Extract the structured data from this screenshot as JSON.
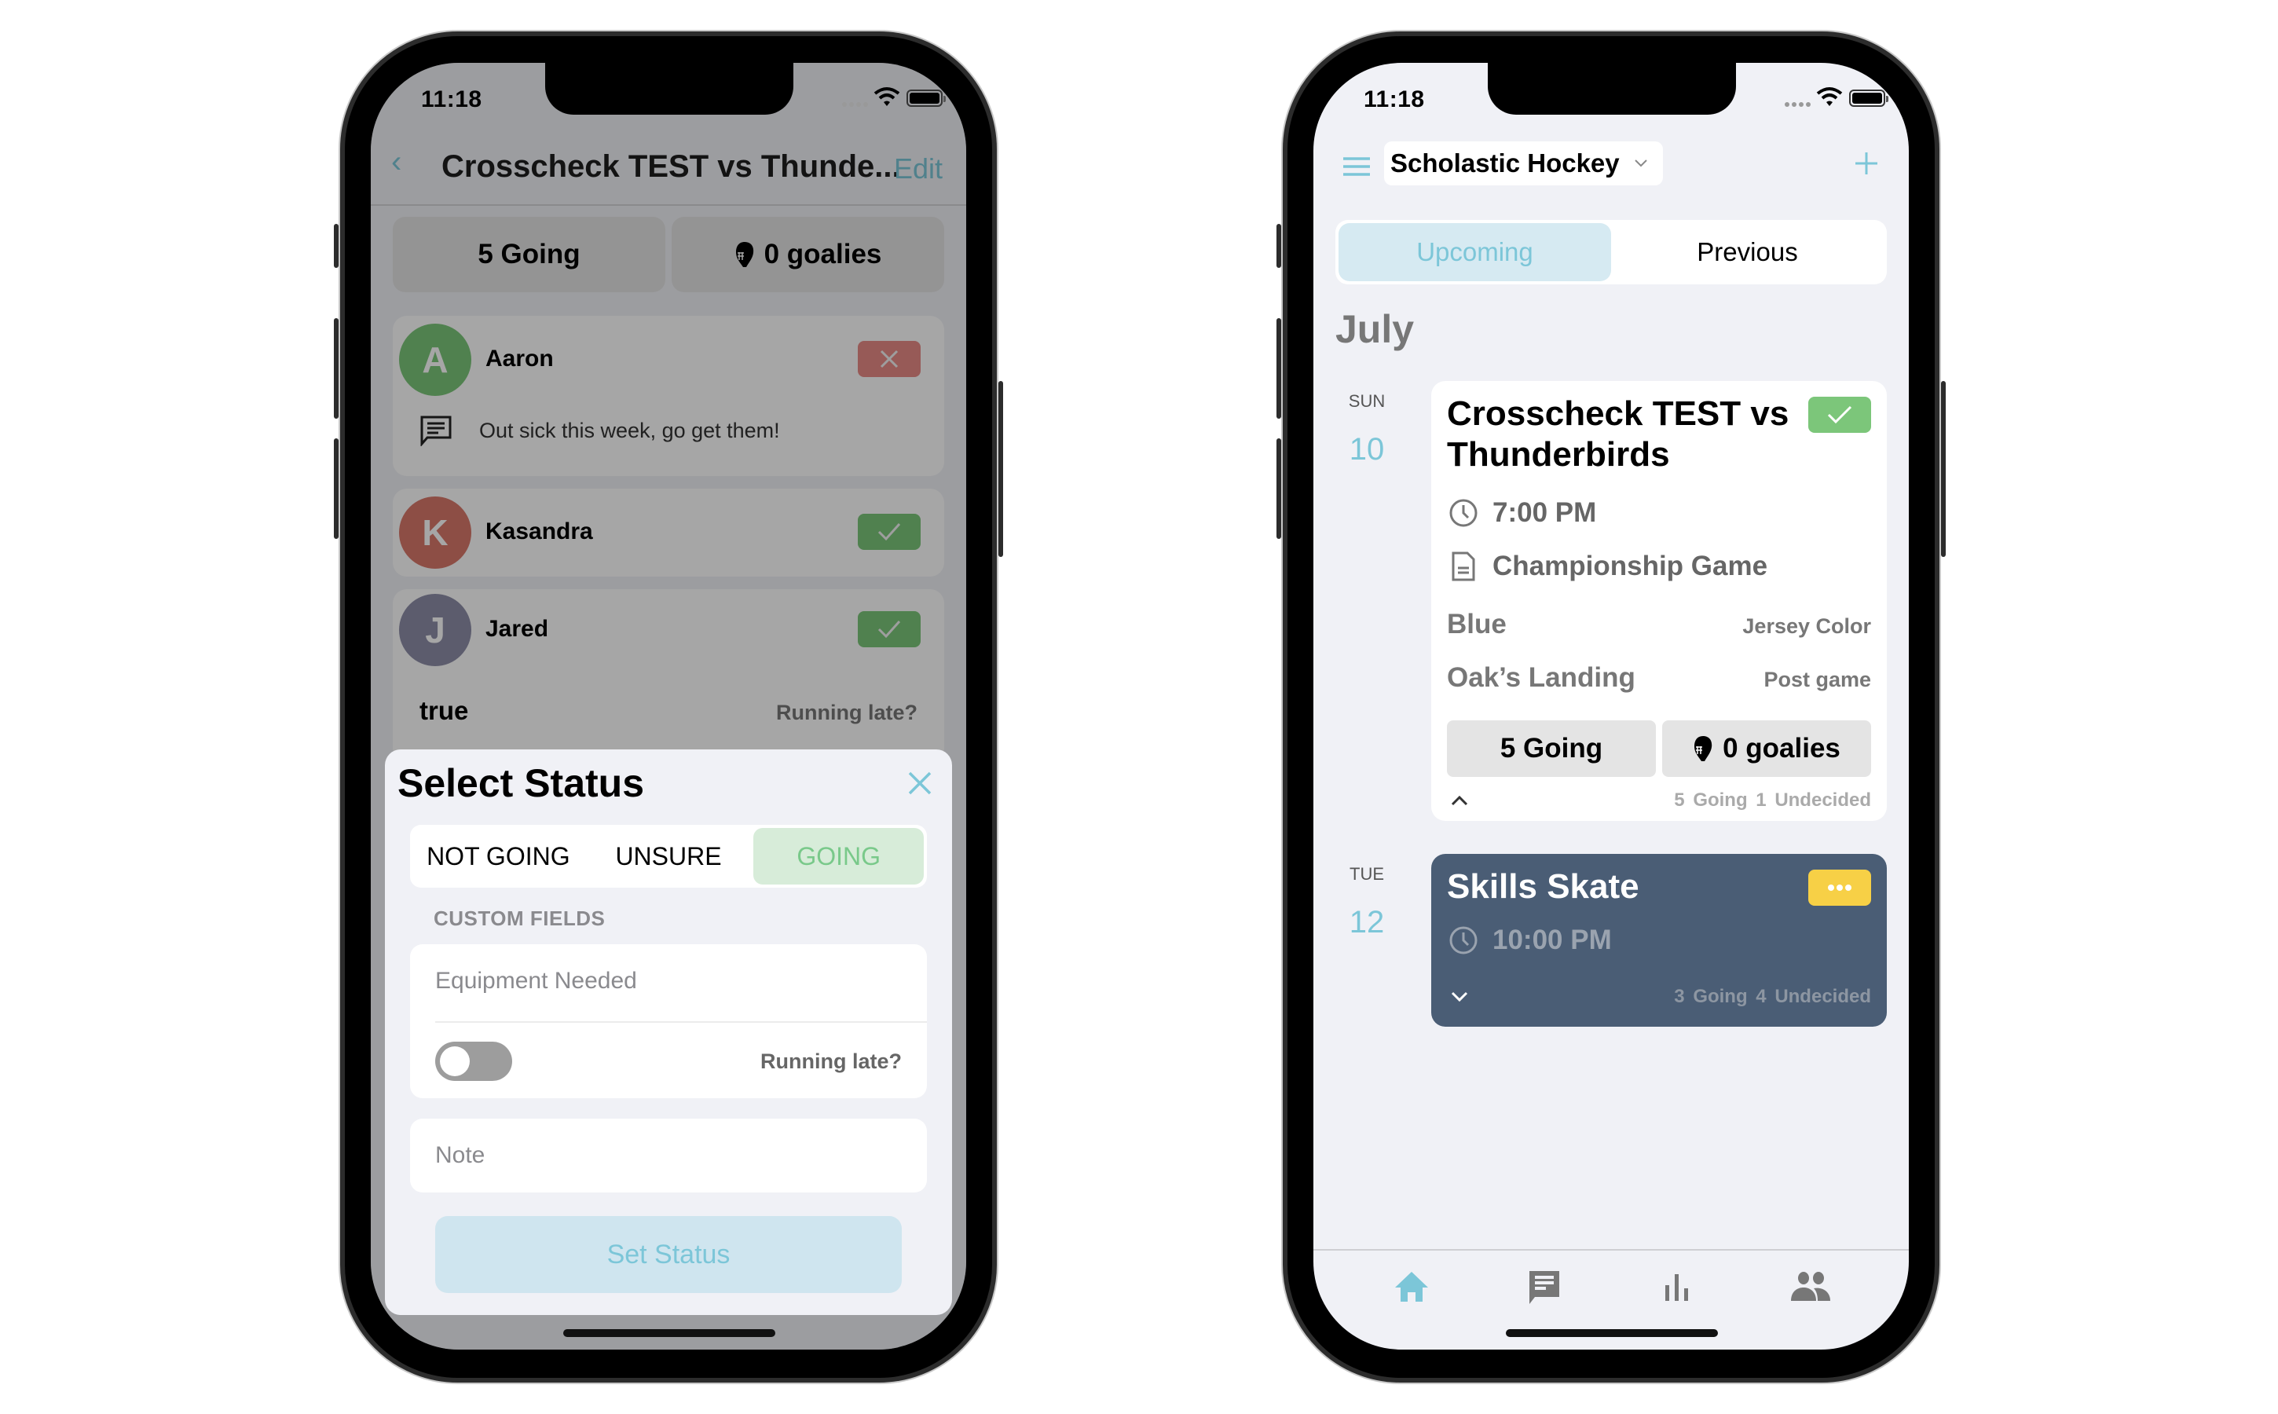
{
  "left_phone": {
    "status_bar": {
      "time": "11:18"
    },
    "nav": {
      "title": "Crosscheck TEST vs Thunde...",
      "back_icon": "chevron-left-icon",
      "edit_label": "Edit"
    },
    "summary": {
      "going": "5 Going",
      "goalies": "0 goalies",
      "goalie_icon": "goalie-mask-icon"
    },
    "roster": [
      {
        "initial": "A",
        "name": "Aaron",
        "status": "not-going",
        "avatar_color": "#7cc67a",
        "note": "Out sick this week, go get them!"
      },
      {
        "initial": "K",
        "name": "Kasandra",
        "status": "going",
        "avatar_color": "#d9786b"
      },
      {
        "initial": "J",
        "name": "Jared",
        "status": "going",
        "avatar_color": "#8e8ea8",
        "custom_value": "true",
        "custom_label": "Running late?"
      }
    ],
    "modal": {
      "title": "Select Status",
      "close_icon": "close-icon",
      "options": [
        {
          "label": "NOT GOING",
          "selected": false
        },
        {
          "label": "UNSURE",
          "selected": false
        },
        {
          "label": "GOING",
          "selected": true
        }
      ],
      "custom_fields_label": "CUSTOM FIELDS",
      "equipment_placeholder": "Equipment Needed",
      "running_late_label": "Running late?",
      "running_late_on": false,
      "note_placeholder": "Note",
      "submit_label": "Set Status"
    }
  },
  "right_phone": {
    "status_bar": {
      "time": "11:18"
    },
    "header": {
      "menu_icon": "hamburger-menu-icon",
      "team_name": "Scholastic Hockey",
      "add_icon": "plus-icon"
    },
    "tabs": [
      {
        "label": "Upcoming",
        "active": true
      },
      {
        "label": "Previous",
        "active": false
      }
    ],
    "month": "July",
    "events": [
      {
        "dow": "SUN",
        "day": "10",
        "title": "Crosscheck TEST vs Thunderbirds",
        "rsvp": "going",
        "time": "7:00 PM",
        "description": "Championship Game",
        "fields": [
          {
            "value": "Blue",
            "label": "Jersey Color"
          },
          {
            "value": "Oak’s Landing",
            "label": "Post game"
          }
        ],
        "going_pill": "5 Going",
        "goalies_pill": "0 goalies",
        "counts": "5 Going  1 Undecided",
        "expanded": true
      },
      {
        "dow": "TUE",
        "day": "12",
        "title": "Skills Skate",
        "rsvp": "unsure",
        "time": "10:00 PM",
        "counts": "3 Going  4 Undecided",
        "expanded": false
      }
    ],
    "tabbar": [
      {
        "name": "home",
        "icon": "home-icon",
        "active": true
      },
      {
        "name": "chat",
        "icon": "chat-icon",
        "active": false
      },
      {
        "name": "stats",
        "icon": "bar-chart-icon",
        "active": false
      },
      {
        "name": "team",
        "icon": "people-icon",
        "active": false
      }
    ]
  },
  "colors": {
    "accent": "#7cc6d8",
    "going_green": "#7cc67a",
    "not_going_red": "#e88a86",
    "unsure_yellow": "#f7d046",
    "event_dark": "#4a5d75"
  }
}
